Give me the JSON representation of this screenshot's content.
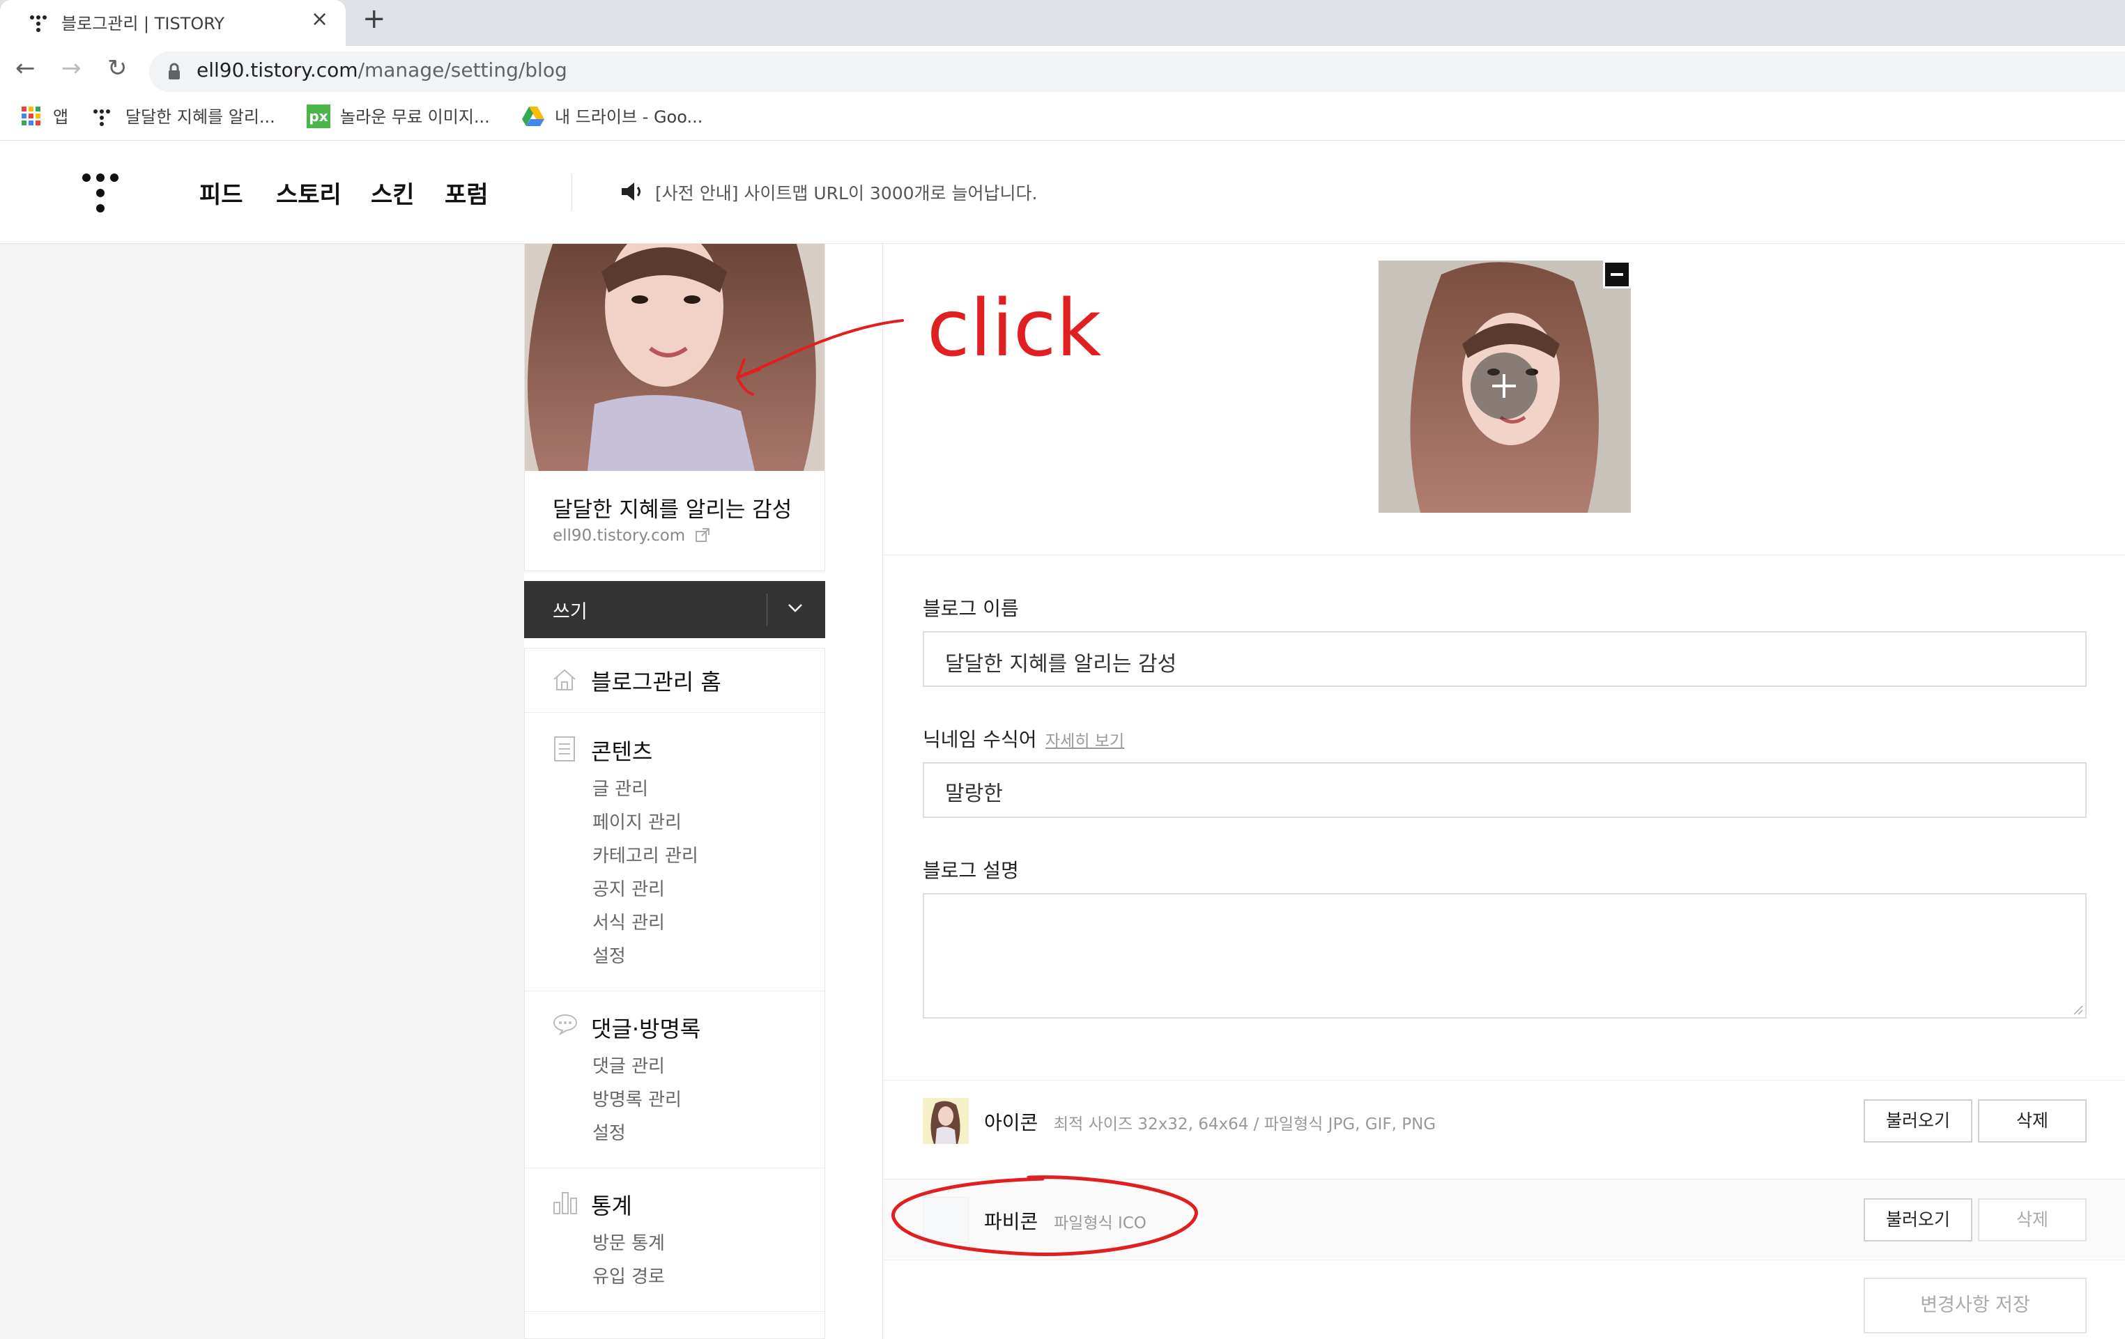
{
  "browser": {
    "tab_title": "블로그관리 | TISTORY",
    "tab_close": "×",
    "new_tab": "+",
    "back": "←",
    "forward": "→",
    "reload": "↻",
    "url_host": "ell90.tistory.com",
    "url_path": "/manage/setting/blog",
    "bookmarks": [
      "앱",
      "달달한 지혜를 알리...",
      "놀라운 무료 이미지...",
      "내 드라이브 - Goo..."
    ],
    "px_badge": "px"
  },
  "header": {
    "nav": [
      "피드",
      "스토리",
      "스킨",
      "포럼"
    ],
    "notice": "[사전 안내] 사이트맵 URL이 3000개로 늘어납니다."
  },
  "sidebar": {
    "blog_name": "달달한 지혜를 알리는 감성",
    "blog_url": "ell90.tistory.com",
    "write_label": "쓰기",
    "home": "블로그관리 홈",
    "contents": {
      "title": "콘텐츠",
      "items": [
        "글 관리",
        "페이지 관리",
        "카테고리 관리",
        "공지 관리",
        "서식 관리",
        "설정"
      ]
    },
    "comments": {
      "title": "댓글·방명록",
      "items": [
        "댓글 관리",
        "방명록 관리",
        "설정"
      ]
    },
    "stats": {
      "title": "통계",
      "items": [
        "방문 통계",
        "유입 경로"
      ]
    }
  },
  "annotation": {
    "text": "click",
    "color": "#e02020"
  },
  "form": {
    "blog_name_label": "블로그 이름",
    "blog_name_value": "달달한 지혜를 알리는 감성",
    "nickname_label": "닉네임 수식어",
    "nickname_link": "자세히 보기",
    "nickname_value": "말랑한",
    "desc_label": "블로그 설명",
    "desc_value": "",
    "icon_label": "아이콘",
    "icon_help": "최적 사이즈 32x32, 64x64 / 파일형식 JPG, GIF, PNG",
    "favicon_label": "파비콘",
    "favicon_help": "파일형식 ICO",
    "load_button": "불러오기",
    "delete_button": "삭제",
    "save_button": "변경사항 저장"
  },
  "colors": {
    "dark_button": "#333333",
    "accent_red": "#e02020"
  }
}
